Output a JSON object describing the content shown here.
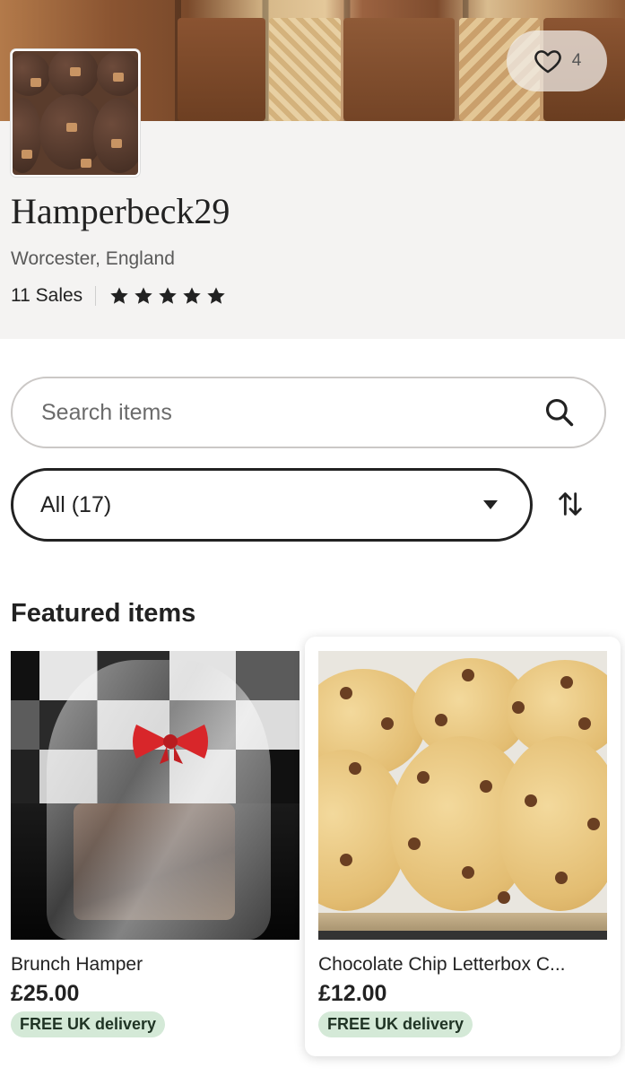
{
  "shop": {
    "name": "Hamperbeck29",
    "location": "Worcester, England",
    "sales": "11 Sales",
    "rating_stars": 5,
    "favorites_count": "4"
  },
  "search": {
    "placeholder": "Search items",
    "value": ""
  },
  "filter": {
    "selected": "All (17)"
  },
  "featured": {
    "title": "Featured items",
    "items": [
      {
        "title": "Brunch Hamper",
        "price": "£25.00",
        "badge": "FREE UK delivery"
      },
      {
        "title": "Chocolate Chip Letterbox C...",
        "price": "£12.00",
        "badge": "FREE UK delivery"
      }
    ]
  },
  "colors": {
    "badge_bg": "#d4e9d7",
    "header_bg": "#f4f3f2",
    "text": "#222222"
  },
  "icons": {
    "favorite": "heart-outline-icon",
    "search": "magnifier-icon",
    "sort": "sort-arrows-icon",
    "rating": "star-icon",
    "dropdown": "caret-down-icon"
  }
}
